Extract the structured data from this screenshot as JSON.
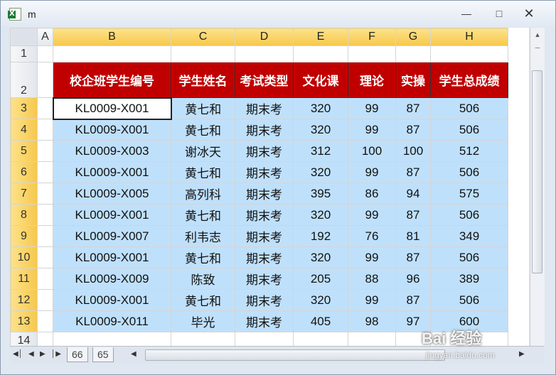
{
  "window": {
    "title": "m"
  },
  "columns": [
    "A",
    "B",
    "C",
    "D",
    "E",
    "F",
    "G",
    "H"
  ],
  "row_numbers": [
    "1",
    "2",
    "3",
    "4",
    "5",
    "6",
    "7",
    "8",
    "9",
    "10",
    "11",
    "12",
    "13",
    "14"
  ],
  "table": {
    "headers": [
      "校企班学生编号",
      "学生姓名",
      "考试类型",
      "文化课",
      "理论",
      "实操",
      "学生总成绩"
    ],
    "rows": [
      [
        "KL0009-X001",
        "黄七和",
        "期末考",
        "320",
        "99",
        "87",
        "506"
      ],
      [
        "KL0009-X001",
        "黄七和",
        "期末考",
        "320",
        "99",
        "87",
        "506"
      ],
      [
        "KL0009-X003",
        "谢冰天",
        "期末考",
        "312",
        "100",
        "100",
        "512"
      ],
      [
        "KL0009-X001",
        "黄七和",
        "期末考",
        "320",
        "99",
        "87",
        "506"
      ],
      [
        "KL0009-X005",
        "高列科",
        "期末考",
        "395",
        "86",
        "94",
        "575"
      ],
      [
        "KL0009-X001",
        "黄七和",
        "期末考",
        "320",
        "99",
        "87",
        "506"
      ],
      [
        "KL0009-X007",
        "利韦志",
        "期末考",
        "192",
        "76",
        "81",
        "349"
      ],
      [
        "KL0009-X001",
        "黄七和",
        "期末考",
        "320",
        "99",
        "87",
        "506"
      ],
      [
        "KL0009-X009",
        "陈致",
        "期末考",
        "205",
        "88",
        "96",
        "389"
      ],
      [
        "KL0009-X001",
        "黄七和",
        "期末考",
        "320",
        "99",
        "87",
        "506"
      ],
      [
        "KL0009-X011",
        "毕光",
        "期末考",
        "405",
        "98",
        "97",
        "600"
      ]
    ]
  },
  "sheet_tabs": [
    "66",
    "65"
  ],
  "watermark": {
    "text": "Bai 经验",
    "sub": "jingyan.baidu.com"
  },
  "colors": {
    "header_bg": "#c00000",
    "cell_bg": "#bfe0fb",
    "selected_header": "#f6c84c"
  }
}
